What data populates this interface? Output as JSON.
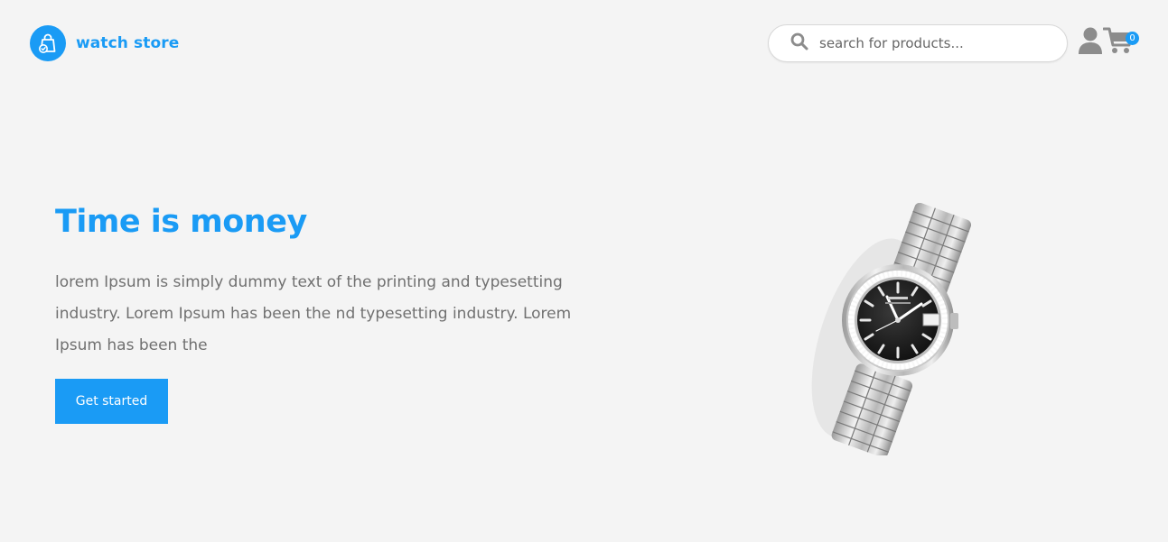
{
  "brand": {
    "name": "watch store",
    "logo_icon": "shopping-bag-check-icon",
    "accent_color": "#1a9bf5"
  },
  "search": {
    "placeholder": "search for products...",
    "icon": "search-icon"
  },
  "header_icons": {
    "user_icon": "user-icon",
    "cart_icon": "cart-icon",
    "cart_count": "0"
  },
  "hero": {
    "title": "Time is money",
    "description": "lorem Ipsum is simply dummy text of the printing and typesetting industry. Lorem Ipsum has been the nd typesetting industry. Lorem Ipsum has been the",
    "cta_label": "Get started",
    "image": "wristwatch-image"
  },
  "colors": {
    "background": "#f4f4f4",
    "text_muted": "#707070",
    "icon_gray": "#8c8c8c"
  }
}
